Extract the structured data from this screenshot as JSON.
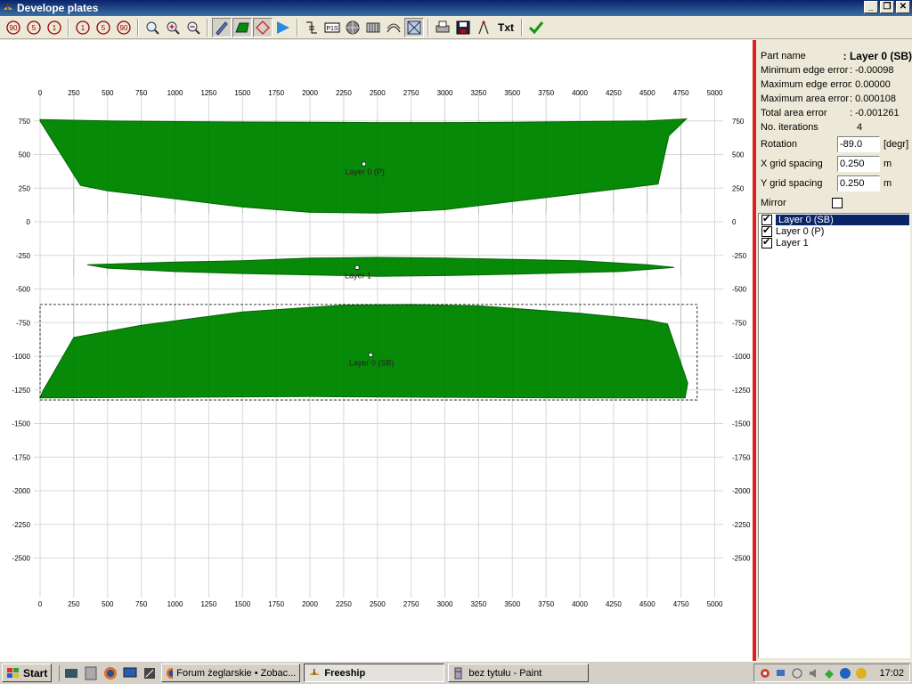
{
  "window": {
    "title": "Develope plates",
    "min": "_",
    "max": "❐",
    "close": "✕"
  },
  "toolbar": {
    "rot_minus90": "90",
    "rot_minus5": "5",
    "rot_minus1": "1",
    "rot_plus1": "1",
    "rot_plus5": "5",
    "rot_plus90": "90",
    "ps_label": "P1S",
    "txt_label": "Txt"
  },
  "colors": {
    "plate_fill": "#078a07",
    "plate_stroke": "#066606",
    "grid": "#d8d8d8",
    "accent": "#e02020"
  },
  "axes": {
    "x_ticks": [
      "0",
      "250",
      "500",
      "750",
      "1000",
      "1250",
      "1500",
      "1750",
      "2000",
      "2250",
      "2500",
      "2750",
      "3000",
      "3250",
      "3500",
      "3750",
      "4000",
      "4250",
      "4500",
      "4750",
      "5000"
    ],
    "y_ticks": [
      "750",
      "500",
      "250",
      "0",
      "-250",
      "-500",
      "-750",
      "-1000",
      "-1250",
      "-1500",
      "-1750",
      "-2000",
      "-2250",
      "-2500"
    ]
  },
  "plates": [
    {
      "label": "Layer 0 (P)"
    },
    {
      "label": "Layer 1"
    },
    {
      "label": "Layer 0 (SB)"
    }
  ],
  "properties": {
    "part_name_label": "Part name",
    "part_name_value": ": Layer 0 (SB)",
    "min_edge_label": "Minimum edge error",
    "min_edge_value": ": -0.00098",
    "max_edge_label": "Maximum edge error",
    "max_edge_value": ": 0.00000",
    "max_area_label": "Maximum area error",
    "max_area_value": ": 0.000108",
    "total_area_label": "Total area error",
    "total_area_value": ": -0.001261",
    "iterations_label": "No. iterations",
    "iterations_value": "4",
    "rotation_label": "Rotation",
    "rotation_value": "-89.0",
    "rotation_unit": "[degr]",
    "xgrid_label": "X grid spacing",
    "xgrid_value": "0.250",
    "xgrid_unit": "m",
    "ygrid_label": "Y grid spacing",
    "ygrid_value": "0.250",
    "ygrid_unit": "m",
    "mirror_label": "Mirror"
  },
  "layers": [
    {
      "label": "Layer 0 (SB)",
      "checked": true,
      "selected": true
    },
    {
      "label": "Layer 0 (P)",
      "checked": true,
      "selected": false
    },
    {
      "label": "Layer 1",
      "checked": true,
      "selected": false
    }
  ],
  "taskbar": {
    "start": "Start",
    "tasks": [
      {
        "label": "Forum żeglarskie • Zobac...",
        "active": false
      },
      {
        "label": "Freeship",
        "active": true
      },
      {
        "label": "bez tytułu - Paint",
        "active": false
      }
    ],
    "clock": "17:02"
  }
}
